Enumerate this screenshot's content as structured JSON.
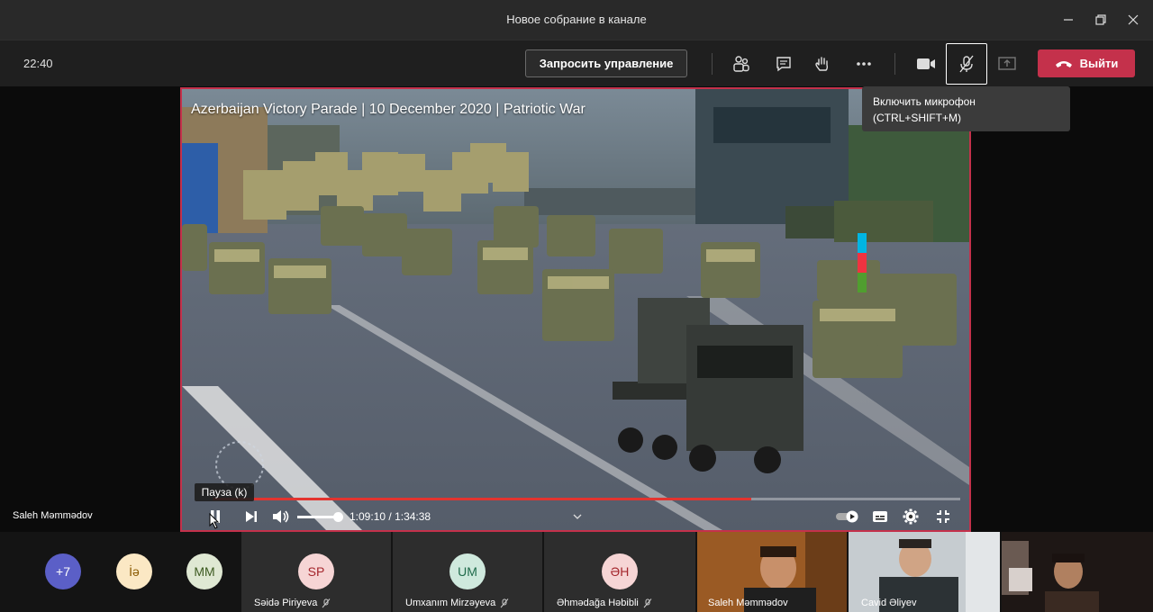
{
  "window": {
    "title": "Новое собрание в канале"
  },
  "toolbar": {
    "clock": "22:40",
    "request_control_label": "Запросить управление",
    "leave_label": "Выйти"
  },
  "mic_tooltip": {
    "line1": "Включить микрофон",
    "line2": "(CTRL+SHIFT+M)"
  },
  "video": {
    "title": "Azerbaijan Victory Parade | 10 December 2020 | Patriotic War",
    "current_time": "1:09:10",
    "duration": "1:34:38",
    "progress_fraction": 0.72,
    "pause_tooltip": "Пауза (k)"
  },
  "presenter": {
    "name": "Saleh Məmmədov"
  },
  "participants": [
    {
      "initials": "+7",
      "color": "#5b5fc7",
      "text_color": "#ffffff"
    },
    {
      "initials": "İə",
      "color": "#fbe8c4",
      "text_color": "#8a5a00"
    },
    {
      "initials": "MM",
      "color": "#dfe8d3",
      "text_color": "#3c5a20"
    },
    {
      "initials": "SP",
      "color": "#f6d5d5",
      "text_color": "#a4262c",
      "name": "Səidə Piriyeva"
    },
    {
      "initials": "UM",
      "color": "#cfe9dd",
      "text_color": "#1f6a4a",
      "name": "Umxanım Mirzəyeva"
    },
    {
      "initials": "ƏH",
      "color": "#f6d5d5",
      "text_color": "#a4262c",
      "name": "Əhmədağa Həbibli"
    }
  ],
  "video_participants": [
    {
      "name": "Saleh Məmmədov"
    },
    {
      "name": "Cavid Əliyev"
    }
  ]
}
